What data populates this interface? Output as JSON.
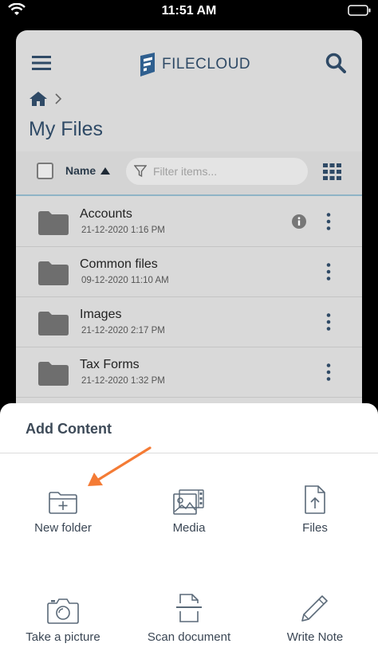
{
  "status_bar": {
    "time": "11:51 AM"
  },
  "app": {
    "logo_text": "FILECLOUD",
    "page_title": "My Files"
  },
  "toolbar": {
    "sort_label": "Name",
    "filter_placeholder": "Filter items..."
  },
  "files": [
    {
      "name": "Accounts",
      "date": "21-12-2020 1:16 PM"
    },
    {
      "name": "Common files",
      "date": "09-12-2020 11:10 AM"
    },
    {
      "name": "Images",
      "date": "21-12-2020 2:17 PM"
    },
    {
      "name": "Tax Forms",
      "date": "21-12-2020 1:32 PM"
    }
  ],
  "sheet": {
    "title": "Add Content",
    "options": [
      {
        "label": "New folder",
        "icon": "folder-plus-icon"
      },
      {
        "label": "Media",
        "icon": "media-icon"
      },
      {
        "label": "Files",
        "icon": "file-upload-icon"
      },
      {
        "label": "Take a picture",
        "icon": "camera-icon"
      },
      {
        "label": "Scan document",
        "icon": "scan-icon"
      },
      {
        "label": "Write Note",
        "icon": "pencil-icon"
      }
    ]
  },
  "colors": {
    "brand": "#2f4a66",
    "accent_arrow": "#f47b35",
    "folder": "#6e6e6e"
  }
}
